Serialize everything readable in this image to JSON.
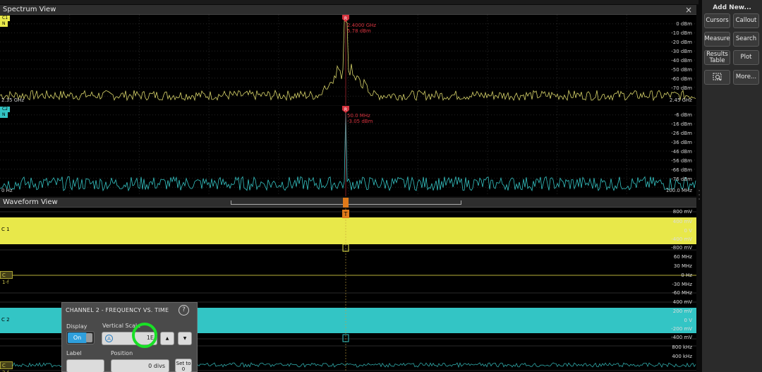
{
  "spectrum_view": {
    "title": "Spectrum View",
    "close": "×",
    "trace1": {
      "marker_letter": "R",
      "marker_freq": "2.4000 GHz",
      "marker_level": "5.78 dBm",
      "scale": [
        "0 dBm",
        "-10 dBm",
        "-20 dBm",
        "-30 dBm",
        "-40 dBm",
        "-50 dBm",
        "-60 dBm",
        "-70 dBm"
      ],
      "channel_tag": "C1",
      "n_tag": "N",
      "left_freq": "2.35 GHz",
      "right_freq": "2.45 GHz",
      "color": "#d9d56a"
    },
    "trace2": {
      "marker_letter": "R",
      "marker_freq": "50.0 MHz",
      "marker_level": "-3.05 dBm",
      "scale": [
        "-6 dBm",
        "-16 dBm",
        "-26 dBm",
        "-36 dBm",
        "-46 dBm",
        "-56 dBm",
        "-66 dBm",
        "-76 dBm"
      ],
      "channel_tag": "C2",
      "n_tag": "N",
      "left_freq": "0 Hz",
      "right_freq": "100.0 MHz",
      "color": "#35c3c3"
    }
  },
  "waveform_view": {
    "title": "Waveform View",
    "marker_t": "T",
    "scale_c1": [
      "800 mV",
      "400 mV",
      "0 V",
      "-400 mV",
      "-800 mV"
    ],
    "scale_c1f": [
      "60 MHz",
      "30 MHz",
      "0 Hz",
      "-30 MHz",
      "-60 MHz"
    ],
    "scale_c2": [
      "400 mV",
      "200 mV",
      "0 V",
      "-200 mV",
      "-400 mV"
    ],
    "scale_c2f": [
      "800 kHz",
      "400 kHz"
    ],
    "tags": {
      "c1": "C 1",
      "c1f": "C 1-f",
      "c2": "C 2",
      "c2f": "C 2-f"
    },
    "colors": {
      "c1": "#e8e84a",
      "c2": "#33c5c5"
    }
  },
  "sidebar": {
    "title": "Add New...",
    "buttons": [
      "Cursors",
      "Callout",
      "Measure",
      "Search",
      "Results Table",
      "Plot",
      "More..."
    ],
    "zoom_icon": "zoom-box-icon"
  },
  "dialog": {
    "title": "CHANNEL 2 - FREQUENCY VS. TIME",
    "help": "?",
    "display_label": "Display",
    "display_value": "On",
    "vscale_label": "Vertical Scale",
    "vscale_value": "1E",
    "label_label": "Label",
    "position_label": "Position",
    "position_value": "0 divs",
    "set0_label": "Set to 0",
    "up": "▲",
    "down": "▼"
  }
}
